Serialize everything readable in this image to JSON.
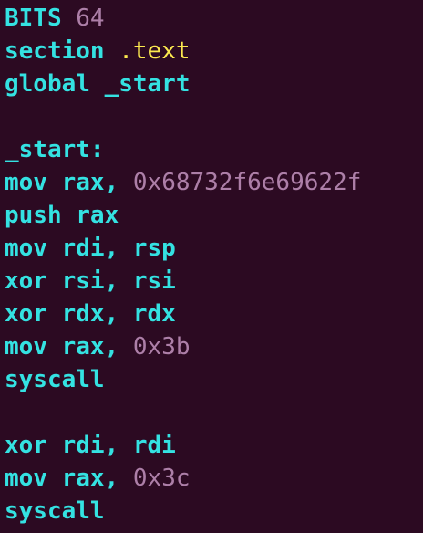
{
  "editor": {
    "colors": {
      "background": "#2c0a22",
      "keyword": "#34e2e2",
      "number": "#ad7fa8",
      "string": "#fce94f"
    },
    "lines": {
      "l1": {
        "kw": "BITS ",
        "num": "64"
      },
      "l2": {
        "kw": "section ",
        "str": ".text"
      },
      "l3": {
        "kw": "global _start"
      },
      "l5": {
        "kw": "_start:"
      },
      "l6": {
        "kw": "mov rax, ",
        "num": "0x68732f6e69622f"
      },
      "l7": {
        "kw": "push rax"
      },
      "l8": {
        "kw": "mov rdi, rsp"
      },
      "l9": {
        "kw": "xor rsi, rsi"
      },
      "l10": {
        "kw": "xor rdx, rdx"
      },
      "l11": {
        "kw": "mov rax, ",
        "num": "0x3b"
      },
      "l12": {
        "kw": "syscall"
      },
      "l14": {
        "kw": "xor rdi, rdi"
      },
      "l15": {
        "kw": "mov rax, ",
        "num": "0x3c"
      },
      "l16": {
        "kw": "syscall"
      }
    }
  }
}
